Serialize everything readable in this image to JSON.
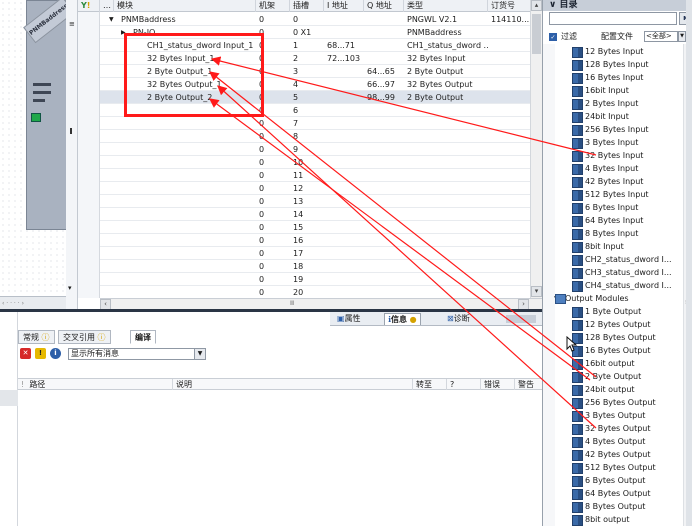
{
  "table": {
    "headers": [
      "模块",
      "机架",
      "插槽",
      "I 地址",
      "Q 地址",
      "类型",
      "订货号"
    ],
    "rows": [
      {
        "module": "PNMBaddress",
        "rack": "0",
        "slot": "0",
        "i_addr": "",
        "q_addr": "",
        "type": "PNGWL V2.1",
        "order": "114110...",
        "expand": "▼"
      },
      {
        "module": "PN-IO",
        "rack": "0",
        "slot": "0 X1",
        "i_addr": "",
        "q_addr": "",
        "type": "PNMBaddress",
        "order": "",
        "expand": "▶"
      },
      {
        "module": "CH1_status_dword Input_1",
        "rack": "0",
        "slot": "1",
        "i_addr": "68...71",
        "q_addr": "",
        "type": "CH1_status_dword ...",
        "order": "",
        "expand": ""
      },
      {
        "module": "32 Bytes Input_1",
        "rack": "0",
        "slot": "2",
        "i_addr": "72...103",
        "q_addr": "",
        "type": "32 Bytes Input",
        "order": "",
        "expand": ""
      },
      {
        "module": "2 Byte Output_1",
        "rack": "0",
        "slot": "3",
        "i_addr": "",
        "q_addr": "64...65",
        "type": "2 Byte Output",
        "order": "",
        "expand": ""
      },
      {
        "module": "32 Bytes Output_1",
        "rack": "0",
        "slot": "4",
        "i_addr": "",
        "q_addr": "66...97",
        "type": "32 Bytes Output",
        "order": "",
        "expand": ""
      },
      {
        "module": "2 Byte Output_2",
        "rack": "0",
        "slot": "5",
        "i_addr": "",
        "q_addr": "98...99",
        "type": "2 Byte Output",
        "order": "",
        "expand": ""
      },
      {
        "module": "",
        "rack": "0",
        "slot": "6",
        "i_addr": "",
        "q_addr": "",
        "type": "",
        "order": "",
        "expand": ""
      },
      {
        "module": "",
        "rack": "0",
        "slot": "7",
        "i_addr": "",
        "q_addr": "",
        "type": "",
        "order": "",
        "expand": ""
      },
      {
        "module": "",
        "rack": "0",
        "slot": "8",
        "i_addr": "",
        "q_addr": "",
        "type": "",
        "order": "",
        "expand": ""
      },
      {
        "module": "",
        "rack": "0",
        "slot": "9",
        "i_addr": "",
        "q_addr": "",
        "type": "",
        "order": "",
        "expand": ""
      },
      {
        "module": "",
        "rack": "0",
        "slot": "10",
        "i_addr": "",
        "q_addr": "",
        "type": "",
        "order": "",
        "expand": ""
      },
      {
        "module": "",
        "rack": "0",
        "slot": "11",
        "i_addr": "",
        "q_addr": "",
        "type": "",
        "order": "",
        "expand": ""
      },
      {
        "module": "",
        "rack": "0",
        "slot": "12",
        "i_addr": "",
        "q_addr": "",
        "type": "",
        "order": "",
        "expand": ""
      },
      {
        "module": "",
        "rack": "0",
        "slot": "13",
        "i_addr": "",
        "q_addr": "",
        "type": "",
        "order": "",
        "expand": ""
      },
      {
        "module": "",
        "rack": "0",
        "slot": "14",
        "i_addr": "",
        "q_addr": "",
        "type": "",
        "order": "",
        "expand": ""
      },
      {
        "module": "",
        "rack": "0",
        "slot": "15",
        "i_addr": "",
        "q_addr": "",
        "type": "",
        "order": "",
        "expand": ""
      },
      {
        "module": "",
        "rack": "0",
        "slot": "16",
        "i_addr": "",
        "q_addr": "",
        "type": "",
        "order": "",
        "expand": ""
      },
      {
        "module": "",
        "rack": "0",
        "slot": "17",
        "i_addr": "",
        "q_addr": "",
        "type": "",
        "order": "",
        "expand": ""
      },
      {
        "module": "",
        "rack": "0",
        "slot": "18",
        "i_addr": "",
        "q_addr": "",
        "type": "",
        "order": "",
        "expand": ""
      },
      {
        "module": "",
        "rack": "0",
        "slot": "19",
        "i_addr": "",
        "q_addr": "",
        "type": "",
        "order": "",
        "expand": ""
      },
      {
        "module": "",
        "rack": "0",
        "slot": "20",
        "i_addr": "",
        "q_addr": "",
        "type": "",
        "order": "",
        "expand": ""
      }
    ]
  },
  "device": {
    "label": "PNMBaddress"
  },
  "props_tabs": {
    "properties": "属性",
    "info": "信息",
    "diagnostics": "诊断"
  },
  "sub_tabs": {
    "general": "常规",
    "cross_ref": "交叉引用",
    "compile": "编译"
  },
  "filter": {
    "selected": "显示所有消息"
  },
  "messages": {
    "headers": {
      "path": "路径",
      "desc": "说明",
      "goto": "转至",
      "q": "?",
      "errors": "错误",
      "warnings": "警告"
    }
  },
  "catalog": {
    "title": "目录",
    "filter_label": "过滤",
    "profile_label": "配置文件",
    "profile_value": "<全部>",
    "inputs": [
      "12 Bytes Input",
      "128 Bytes Input",
      "16 Bytes Input",
      "16bit Input",
      "2 Bytes Input",
      "24bit Input",
      "256 Bytes Input",
      "3 Bytes Input",
      "32 Bytes Input",
      "4 Bytes Input",
      "42 Bytes Input",
      "512 Bytes Input",
      "6 Bytes Input",
      "64 Bytes Input",
      "8 Bytes Input",
      "8bit Input",
      "CH2_status_dword I...",
      "CH3_status_dword I...",
      "CH4_status_dword I..."
    ],
    "output_folder": "Output Modules",
    "outputs": [
      "1 Byte Output",
      "12 Bytes Output",
      "128 Bytes Output",
      "16 Bytes Output",
      "16bit output",
      "2 Byte Output",
      "24bit output",
      "256 Bytes Output",
      "3 Bytes Output",
      "32 Bytes Output",
      "4 Bytes Output",
      "42 Bytes Output",
      "512 Bytes Output",
      "6 Bytes Output",
      "64 Bytes Output",
      "8 Bytes Output",
      "8bit output"
    ]
  },
  "colors": {
    "annotation_red": "#ff1a1a",
    "selection": "#dde3ec",
    "title_bar": "#c7ced8"
  }
}
